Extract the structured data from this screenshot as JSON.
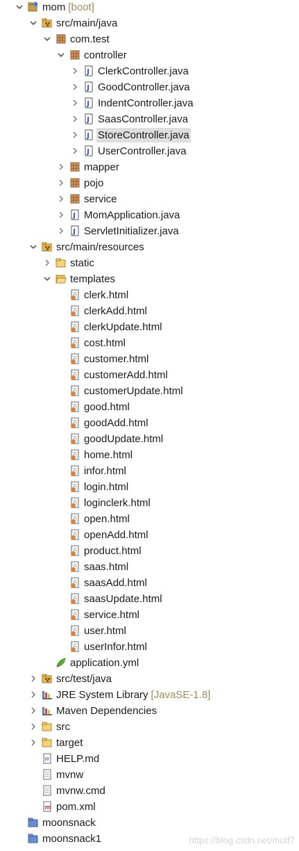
{
  "tree": [
    {
      "d": 0,
      "label": "mom",
      "deco": "[boot]",
      "icon": "project",
      "exp": "open"
    },
    {
      "d": 1,
      "label": "src/main/java",
      "icon": "srcfolder",
      "exp": "open"
    },
    {
      "d": 2,
      "label": "com.test",
      "icon": "package",
      "exp": "open"
    },
    {
      "d": 3,
      "label": "controller",
      "icon": "package",
      "exp": "open"
    },
    {
      "d": 4,
      "label": "ClerkController.java",
      "icon": "java",
      "exp": "closed"
    },
    {
      "d": 4,
      "label": "GoodController.java",
      "icon": "java",
      "exp": "closed"
    },
    {
      "d": 4,
      "label": "IndentController.java",
      "icon": "java",
      "exp": "closed"
    },
    {
      "d": 4,
      "label": "SaasController.java",
      "icon": "java",
      "exp": "closed"
    },
    {
      "d": 4,
      "label": "StoreController.java",
      "icon": "java",
      "exp": "closed",
      "selected": true
    },
    {
      "d": 4,
      "label": "UserController.java",
      "icon": "java",
      "exp": "closed"
    },
    {
      "d": 3,
      "label": "mapper",
      "icon": "package",
      "exp": "closed"
    },
    {
      "d": 3,
      "label": "pojo",
      "icon": "package",
      "exp": "closed"
    },
    {
      "d": 3,
      "label": "service",
      "icon": "package",
      "exp": "closed"
    },
    {
      "d": 3,
      "label": "MomApplication.java",
      "icon": "java",
      "exp": "closed"
    },
    {
      "d": 3,
      "label": "ServletInitializer.java",
      "icon": "java",
      "exp": "closed"
    },
    {
      "d": 1,
      "label": "src/main/resources",
      "icon": "srcfolder",
      "exp": "open"
    },
    {
      "d": 2,
      "label": "static",
      "icon": "folder",
      "exp": "closed"
    },
    {
      "d": 2,
      "label": "templates",
      "icon": "folderopen",
      "exp": "open"
    },
    {
      "d": 3,
      "label": "clerk.html",
      "icon": "html"
    },
    {
      "d": 3,
      "label": "clerkAdd.html",
      "icon": "html"
    },
    {
      "d": 3,
      "label": "clerkUpdate.html",
      "icon": "html"
    },
    {
      "d": 3,
      "label": "cost.html",
      "icon": "html"
    },
    {
      "d": 3,
      "label": "customer.html",
      "icon": "html"
    },
    {
      "d": 3,
      "label": "customerAdd.html",
      "icon": "html"
    },
    {
      "d": 3,
      "label": "customerUpdate.html",
      "icon": "html"
    },
    {
      "d": 3,
      "label": "good.html",
      "icon": "html"
    },
    {
      "d": 3,
      "label": "goodAdd.html",
      "icon": "html"
    },
    {
      "d": 3,
      "label": "goodUpdate.html",
      "icon": "html"
    },
    {
      "d": 3,
      "label": "home.html",
      "icon": "html"
    },
    {
      "d": 3,
      "label": "infor.html",
      "icon": "html"
    },
    {
      "d": 3,
      "label": "login.html",
      "icon": "html"
    },
    {
      "d": 3,
      "label": "loginclerk.html",
      "icon": "html"
    },
    {
      "d": 3,
      "label": "open.html",
      "icon": "html"
    },
    {
      "d": 3,
      "label": "openAdd.html",
      "icon": "html"
    },
    {
      "d": 3,
      "label": "product.html",
      "icon": "html"
    },
    {
      "d": 3,
      "label": "saas.html",
      "icon": "html"
    },
    {
      "d": 3,
      "label": "saasAdd.html",
      "icon": "html"
    },
    {
      "d": 3,
      "label": "saasUpdate.html",
      "icon": "html"
    },
    {
      "d": 3,
      "label": "service.html",
      "icon": "html"
    },
    {
      "d": 3,
      "label": "user.html",
      "icon": "html"
    },
    {
      "d": 3,
      "label": "userInfor.html",
      "icon": "html"
    },
    {
      "d": 2,
      "label": "application.yml",
      "icon": "yml"
    },
    {
      "d": 1,
      "label": "src/test/java",
      "icon": "srcfolder",
      "exp": "closed"
    },
    {
      "d": 1,
      "label": "JRE System Library",
      "deco": "[JavaSE-1.8]",
      "icon": "library",
      "exp": "closed"
    },
    {
      "d": 1,
      "label": "Maven Dependencies",
      "icon": "library",
      "exp": "closed"
    },
    {
      "d": 1,
      "label": "src",
      "icon": "folder",
      "exp": "closed"
    },
    {
      "d": 1,
      "label": "target",
      "icon": "folder",
      "exp": "closed"
    },
    {
      "d": 1,
      "label": "HELP.md",
      "icon": "md"
    },
    {
      "d": 1,
      "label": "mvnw",
      "icon": "textfile"
    },
    {
      "d": 1,
      "label": "mvnw.cmd",
      "icon": "textfile"
    },
    {
      "d": 1,
      "label": "pom.xml",
      "icon": "xml"
    },
    {
      "d": 0,
      "label": "moonsnack",
      "icon": "closedproject"
    },
    {
      "d": 0,
      "label": "moonsnack1",
      "icon": "closedproject"
    }
  ],
  "watermark": "https://blog.csdn.net/mutf7",
  "colors": {
    "selection": "#dedede",
    "decoration": "#a08a5a",
    "package": "#8a5a2b",
    "folder": "#e8b84a",
    "java": "#2b5aa8"
  }
}
